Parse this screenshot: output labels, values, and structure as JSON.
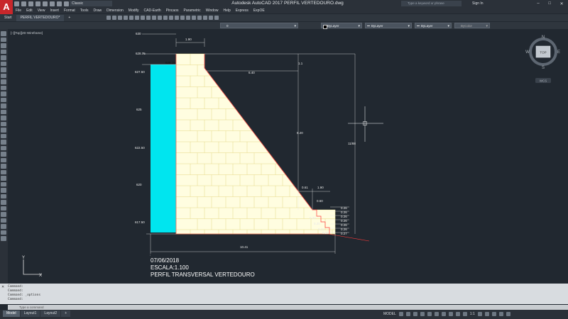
{
  "window": {
    "title": "Autodesk AutoCAD 2017    PERFIL VERTEDOURO.dwg",
    "app_logo": "A",
    "workspace": "Classic",
    "search_placeholder": "Type a keyword or phrase",
    "signin": "Sign In",
    "controls": [
      "–",
      "□",
      "✕"
    ]
  },
  "menu": [
    "File",
    "Edit",
    "View",
    "Insert",
    "Format",
    "Tools",
    "Draw",
    "Dimension",
    "Modify",
    "CAD-Earth",
    "Pincaos",
    "Parametric",
    "Window",
    "Help",
    "Express",
    "ExpOE"
  ],
  "file_tabs": [
    "Start",
    "PERFIL VERTEDOURO*",
    "+"
  ],
  "properties": {
    "layer": "0",
    "color": "ByLayer",
    "linetype": "ByLayer",
    "lineweight": "ByLayer",
    "plotstyle": "ByColor"
  },
  "viewport_label": "[–][Top][2D Wireframe]",
  "viewcube": {
    "n": "N",
    "s": "S",
    "e": "E",
    "w": "W",
    "top": "TOP",
    "wcs": "WCS"
  },
  "ucs": {
    "x": "X",
    "y": "Y"
  },
  "drawing": {
    "elevations": [
      "630",
      "628.75",
      "627.50",
      "625",
      "622.50",
      "620",
      "617.50"
    ],
    "water_level": "628.15",
    "dims": {
      "crest_width": "1.90",
      "upper_offset": "1.1",
      "slope_h": "6.40",
      "height_mid": "8.20",
      "total_height": "11/88",
      "base_length": "10.41",
      "step_w1": "0.61",
      "step_w2": "1.90",
      "step_h": "0.60",
      "step_sizes": [
        "0.20",
        "0.20",
        "0.20",
        "0.28"
      ],
      "stair_heights": [
        "0.26",
        "0.26",
        "0.26",
        "0.26",
        "0.26",
        "0.26",
        "0.27"
      ]
    }
  },
  "info": {
    "date": "07/06/2018",
    "scale": "ESCALA:1.100",
    "title": "PERFIL TRANSVERSAL VERTEDOURO"
  },
  "command": {
    "lines": [
      "Command:",
      "Command:",
      "Command:  _options",
      "Command:"
    ],
    "placeholder": "Type a command",
    "close": "✕"
  },
  "layouts": [
    "Model",
    "Layout1",
    "Layout2",
    "+"
  ],
  "status": {
    "mode": "MODEL",
    "scale": "1:1"
  }
}
